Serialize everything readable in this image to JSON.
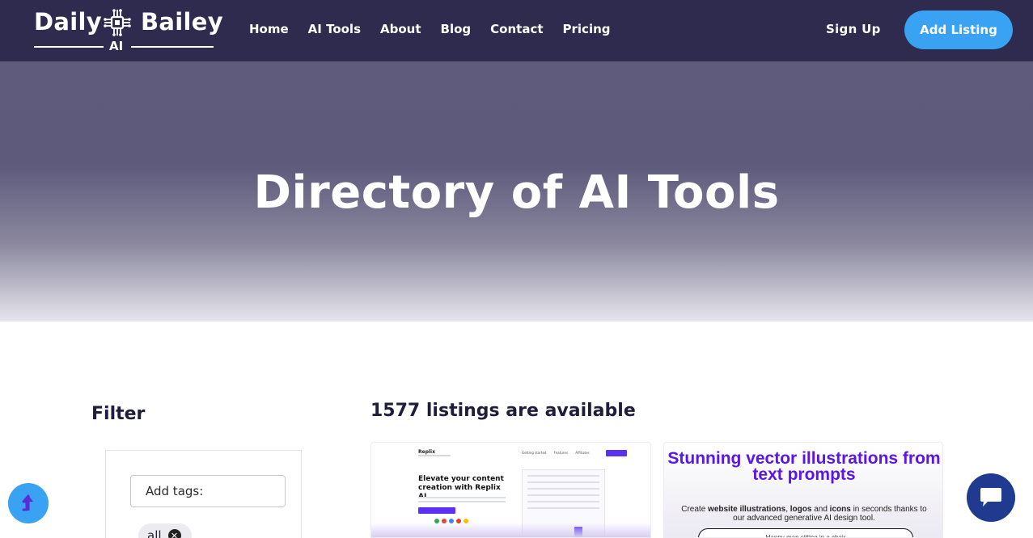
{
  "brand": {
    "word1": "Daily",
    "word2": "Bailey",
    "sub": "AI"
  },
  "nav": {
    "items": [
      "Home",
      "AI Tools",
      "About",
      "Blog",
      "Contact",
      "Pricing"
    ]
  },
  "header": {
    "signup_label": "Sign Up",
    "add_listing_label": "Add Listing"
  },
  "hero": {
    "title": "Directory of AI Tools"
  },
  "filter": {
    "title": "Filter",
    "tags_placeholder": "Add tags:",
    "chip_label": "all"
  },
  "listings": {
    "count_text": "1577 listings are available"
  },
  "card1": {
    "brand": "Replix",
    "headline": "Elevate your content creation with Replix AI",
    "nav": [
      "Getting started",
      "Features",
      "Affiliates"
    ]
  },
  "card2": {
    "headline": "Stunning vector illustrations from text prompts",
    "desc_pre": "Create ",
    "desc_b1": "website illustrations",
    "desc_mid1": ", ",
    "desc_b2": "logos",
    "desc_mid2": " and ",
    "desc_b3": "icons",
    "desc_post": " in seconds thanks to our advanced generative AI design tool.",
    "input_text": "Happy man sitting in a chair"
  },
  "icons": {
    "scroll_up": "arrow-up-icon",
    "chat": "chat-icon",
    "logo_chip": "circuit-chip-icon"
  },
  "colors": {
    "header_bg": "#2f2b4f",
    "accent": "#3aa2f2",
    "chat_button": "#1f3a8f",
    "card2_headline": "#5a16e6"
  }
}
